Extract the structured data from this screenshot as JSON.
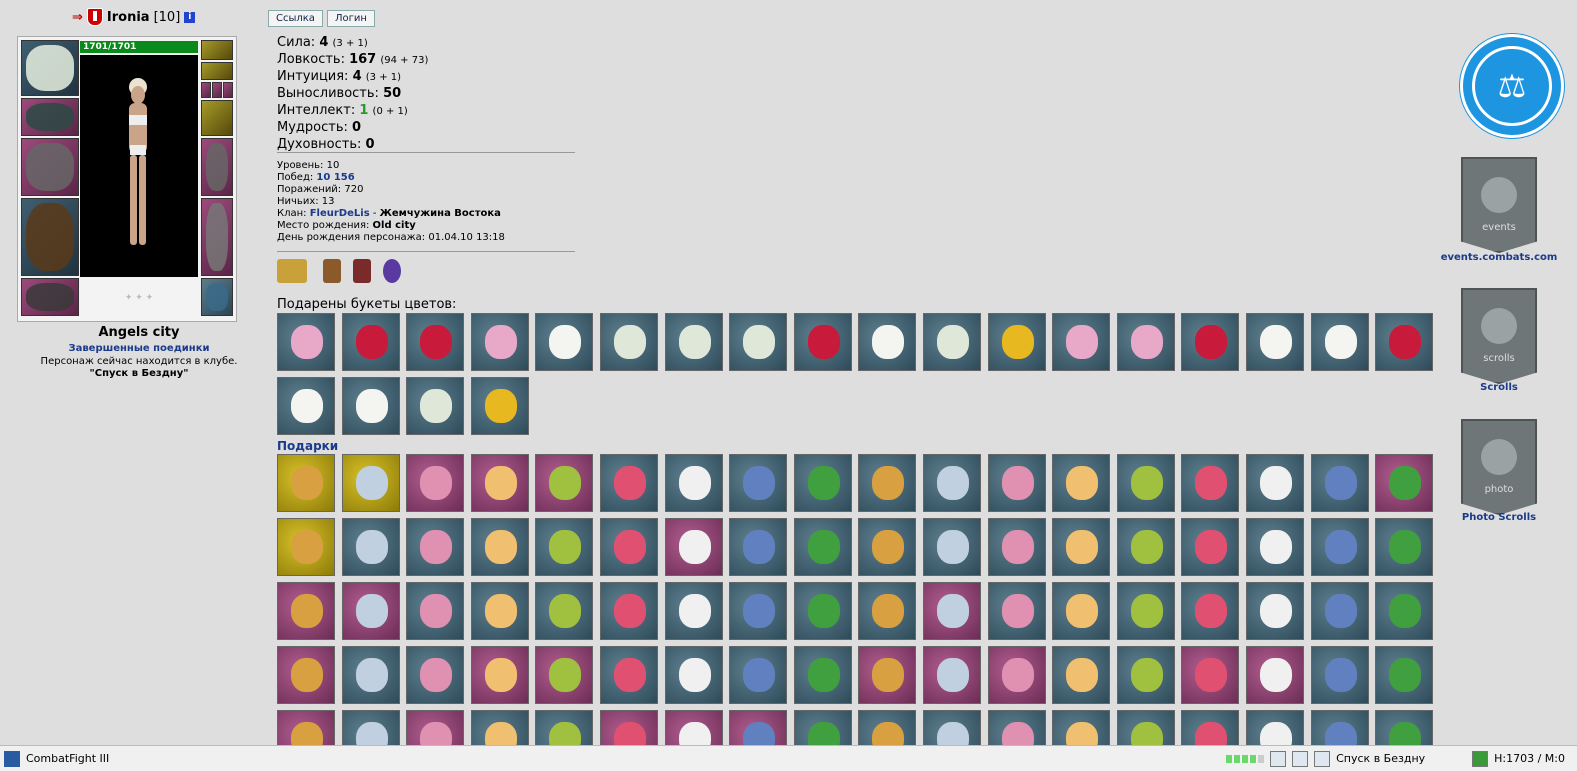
{
  "player": {
    "name": "Ironia",
    "level": "[10]",
    "hp": "1701/1701",
    "city": "Angels city",
    "fights_link": "Завершенные поединки",
    "status_line": "Персонаж сейчас находится в клубе.",
    "location": "\"Спуск в Бездну\""
  },
  "buttons": {
    "link": "Ссылка",
    "login": "Логин"
  },
  "stats": [
    {
      "label": "Сила: ",
      "value": "4",
      "extra": "(3 + 1)"
    },
    {
      "label": "Ловкость: ",
      "value": "167",
      "extra": "(94 + 73)"
    },
    {
      "label": "Интуиция: ",
      "value": "4",
      "extra": "(3 + 1)"
    },
    {
      "label": "Выносливость: ",
      "value": "50",
      "extra": ""
    },
    {
      "label": "Интеллект: ",
      "value": "1",
      "extra": "(0 + 1)"
    },
    {
      "label": "Мудрость: ",
      "value": "0",
      "extra": ""
    },
    {
      "label": "Духовность: ",
      "value": "0",
      "extra": ""
    }
  ],
  "meta": {
    "level": "Уровень: 10",
    "wins_label": "Побед: ",
    "wins": "10 156",
    "losses": "Поражений: 720",
    "draws": "Ничьих: 13",
    "clan_label": "Клан: ",
    "clan_name": "FleurDeLis",
    "clan_sep": " - ",
    "clan_title": "Жемчужина Востока",
    "birthplace_label": "Место рождения: ",
    "birthplace": "Old city",
    "birthday": "День рождения персонажа: 01.04.10 13:18"
  },
  "flowers_title": "Подарены букеты цветов:",
  "gifts_title": "Подарки",
  "flowers": [
    "pink",
    "red",
    "red",
    "pink",
    "daisy",
    "white",
    "white",
    "white",
    "red",
    "daisy",
    "white",
    "yellow",
    "pink",
    "pink",
    "red",
    "daisy",
    "daisy",
    "red",
    "daisy",
    "daisy",
    "white",
    "yellow"
  ],
  "gifts": [
    [
      "gold",
      "gold",
      "mag",
      "mag",
      "mag",
      "blue",
      "blue",
      "blue",
      "blue",
      "blue",
      "blue",
      "blue",
      "blue",
      "blue",
      "blue",
      "blue",
      "blue",
      "mag"
    ],
    [
      "gold",
      "blue",
      "blue",
      "blue",
      "blue",
      "blue",
      "mag",
      "blue",
      "blue",
      "blue",
      "blue",
      "blue",
      "blue",
      "blue",
      "blue",
      "blue",
      "blue",
      "blue"
    ],
    [
      "mag",
      "mag",
      "blue",
      "blue",
      "blue",
      "blue",
      "blue",
      "blue",
      "blue",
      "blue",
      "mag",
      "blue",
      "blue",
      "blue",
      "blue",
      "blue",
      "blue",
      "blue"
    ],
    [
      "mag",
      "blue",
      "blue",
      "mag",
      "mag",
      "blue",
      "blue",
      "blue",
      "blue",
      "mag",
      "mag",
      "mag",
      "blue",
      "blue",
      "mag",
      "mag",
      "blue",
      "blue"
    ],
    [
      "mag",
      "blue",
      "mag",
      "blue",
      "blue",
      "mag",
      "mag",
      "mag",
      "blue",
      "blue",
      "blue",
      "blue",
      "blue",
      "blue",
      "blue",
      "blue",
      "blue",
      "blue"
    ]
  ],
  "side": {
    "events_label": "events.combats.com",
    "events_banner": "events",
    "scrolls_label": "Scrolls",
    "scrolls_banner": "scrolls",
    "photo_label": "Photo Scrolls",
    "photo_banner": "photo"
  },
  "taskbar": {
    "app_title": "CombatFight III",
    "location": "Спуск в Бездну",
    "hm": "H:1703 / M:0"
  },
  "colors": {
    "link": "#1a3a8a",
    "hp": "#0a8a1a",
    "accent_blue": "#1e95e0"
  }
}
